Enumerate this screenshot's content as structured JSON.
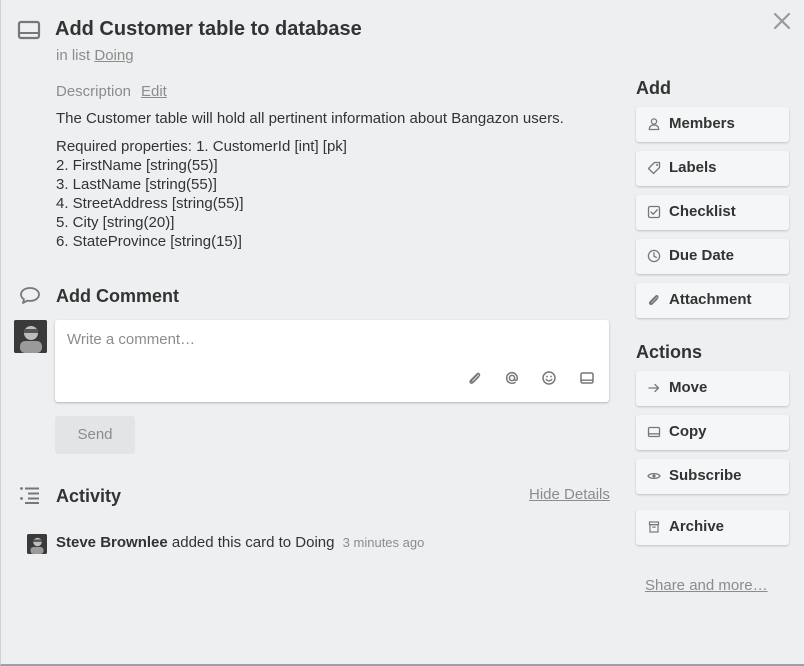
{
  "card": {
    "title": "Add Customer table to database",
    "in_list_prefix": "in list",
    "list_name": "Doing"
  },
  "description": {
    "label": "Description",
    "edit_label": "Edit",
    "text": "The Customer table will hold all pertinent information about Bangazon users.",
    "properties": [
      "Required properties: 1. CustomerId [int] [pk]",
      "2. FirstName [string(55)]",
      "3. LastName [string(55)]",
      "4. StreetAddress [string(55)]",
      "5. City [string(20)]",
      "6. StateProvince [string(15)]"
    ]
  },
  "comment": {
    "title": "Add Comment",
    "placeholder": "Write a comment…",
    "send_label": "Send",
    "icons": [
      "paperclip-icon",
      "at-mention-icon",
      "emoji-icon",
      "card-icon"
    ]
  },
  "activity": {
    "title": "Activity",
    "hide_details_label": "Hide Details",
    "entries": [
      {
        "user": "Steve Brownlee",
        "action": "added this card to Doing",
        "time": "3 minutes ago"
      }
    ]
  },
  "sidebar": {
    "add_heading": "Add",
    "add_buttons": [
      {
        "label": "Members",
        "icon": "person-icon"
      },
      {
        "label": "Labels",
        "icon": "tag-icon"
      },
      {
        "label": "Checklist",
        "icon": "checkbox-icon"
      },
      {
        "label": "Due Date",
        "icon": "clock-icon"
      },
      {
        "label": "Attachment",
        "icon": "paperclip-icon"
      }
    ],
    "actions_heading": "Actions",
    "action_buttons": [
      {
        "label": "Move",
        "icon": "arrow-right-icon"
      },
      {
        "label": "Copy",
        "icon": "card-icon"
      },
      {
        "label": "Subscribe",
        "icon": "eye-icon"
      },
      {
        "label": "Archive",
        "icon": "archive-icon"
      }
    ],
    "share_more_label": "Share and more…"
  },
  "colors": {
    "background": "#edeff0",
    "button_bg": "#f5f6f7",
    "muted_text": "#8c8c8c",
    "primary_text": "#333333"
  }
}
